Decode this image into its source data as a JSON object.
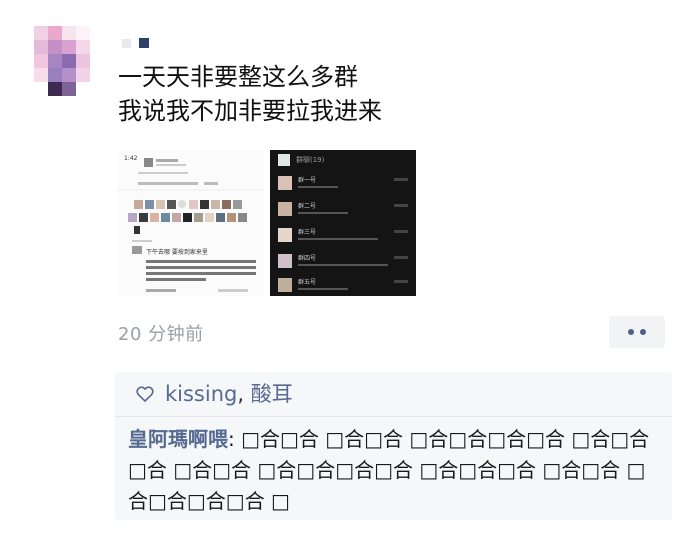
{
  "post": {
    "text_line1": "一天天非要整这么多群",
    "text_line2": "我说我不加非要拉我进来",
    "time": "20 分钟前"
  },
  "likes": {
    "icon": "heart-outline-icon",
    "names": [
      "kissing",
      "酸耳"
    ],
    "separator": ","
  },
  "comment": {
    "author": "皇阿瑪啊喂",
    "colon": ":",
    "text": "□合□合 □合□合 □合□合□合□合 □合□合□合 □合□合 □合□合□合□合 □合□合□合 □合□合 □合□合□合□合 □"
  },
  "thumbnails": {
    "left": {
      "header": "□□□□",
      "status_line": "1:42",
      "row_label": "下午去哪 要按到家来里",
      "text_line": "聊天记录 快乐",
      "footer": "置顶聊天"
    },
    "right": {
      "title": "群聊(19)",
      "rows": [
        "群一号",
        "群二号",
        "群三号",
        "群四号",
        "群五号",
        "群六号"
      ]
    }
  },
  "colors": {
    "link_blue": "#566a93",
    "time_gray": "#9aa0a6",
    "comment_bg": "#f6f7f8"
  }
}
